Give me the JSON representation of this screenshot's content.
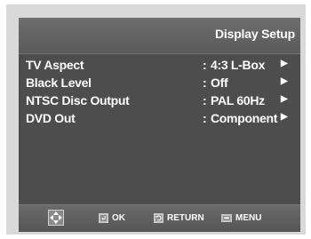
{
  "screen": {
    "title": "Display Setup"
  },
  "menu": [
    {
      "label": "TV Aspect",
      "value": "4:3 L-Box",
      "separator": ":"
    },
    {
      "label": "Black Level",
      "value": "Off",
      "separator": ":"
    },
    {
      "label": "NTSC Disc Output",
      "value": "PAL 60Hz",
      "separator": ":"
    },
    {
      "label": "DVD Out",
      "value": "Component",
      "separator": ":"
    }
  ],
  "footer": {
    "ok_label": "OK",
    "return_label": "RETURN",
    "menu_label": "MENU"
  },
  "icons": {
    "nav": "directional-pad-icon",
    "ok": "enter-key-icon",
    "return": "return-arrow-icon",
    "menu": "menu-key-icon",
    "submenu": "right-triangle-icon"
  },
  "colors": {
    "background": "#4d4d4d",
    "header": "#646464",
    "text": "#ffffff",
    "frame": "#d9d9d9"
  }
}
